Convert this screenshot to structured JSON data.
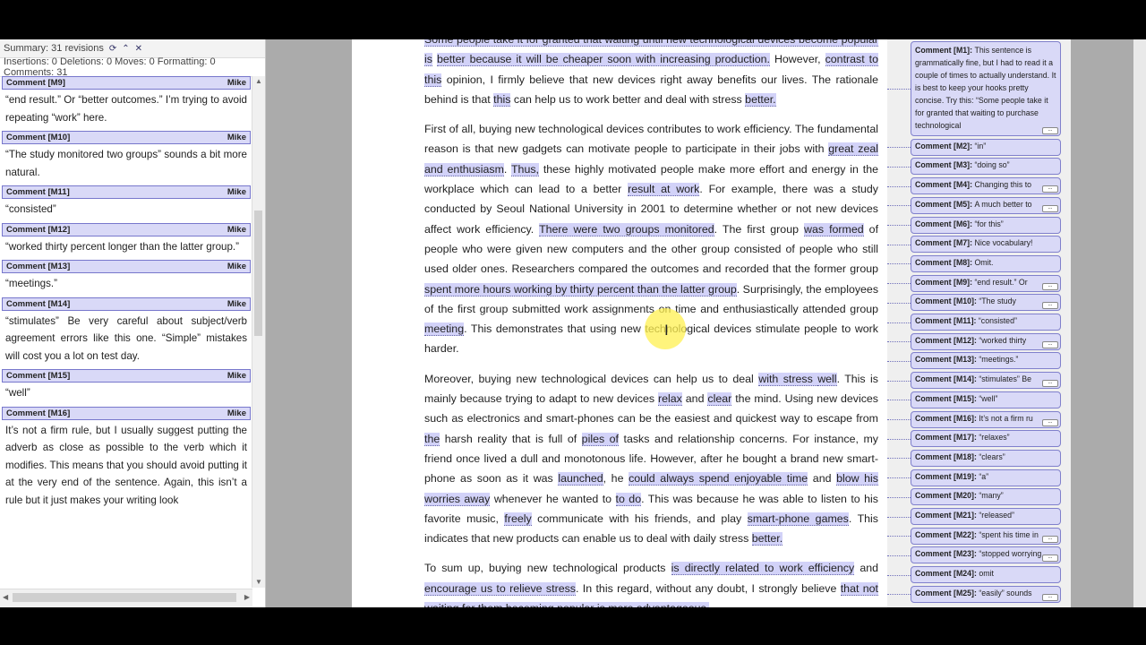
{
  "review_pane": {
    "title": "Summary: 31 revisions",
    "stats": "Insertions: 0 Deletions: 0 Moves: 0 Formatting: 0 Comments: 31",
    "entries": [
      {
        "label": "Comment [M9]",
        "author": "Mike",
        "text": "“end result.”  Or  “better outcomes.”  I’m trying to avoid repeating “work” here."
      },
      {
        "label": "Comment [M10]",
        "author": "Mike",
        "text": "“The study monitored two groups” sounds a bit more natural."
      },
      {
        "label": "Comment [M11]",
        "author": "Mike",
        "text": "“consisted”"
      },
      {
        "label": "Comment [M12]",
        "author": "Mike",
        "text": "“worked thirty percent longer than the latter group.”"
      },
      {
        "label": "Comment [M13]",
        "author": "Mike",
        "text": "“meetings.”"
      },
      {
        "label": "Comment [M14]",
        "author": "Mike",
        "text": "“stimulates”   Be very careful about subject/verb agreement errors like this one.  “Simple” mistakes will cost you a lot on test day."
      },
      {
        "label": "Comment [M15]",
        "author": "Mike",
        "text": "“well”"
      },
      {
        "label": "Comment [M16]",
        "author": "Mike",
        "text": "It’s not a firm rule, but I usually suggest putting the adverb as close as possible to the verb which it modifies.   This means that you should avoid putting it at the very end of the sentence.  Again, this isn’t a rule but it just makes your writing look"
      }
    ]
  },
  "document": {
    "p1": {
      "a": "Some people take it for granted that waiting until new technological devices become popular is",
      "b": "better because it will be cheaper soon with increasing production.",
      "c": " However, ",
      "d": "contrast to this",
      "e": "opinion, I firmly believe that new devices right away benefits our lives. The rationale behind is that ",
      "f": "this",
      "g": " can help us to work better and deal with stress ",
      "h": "better."
    },
    "p2": {
      "a": "First of all, buying new technological devices contributes to work efficiency",
      "b": ". The fundamental ",
      "c": "reason",
      "d": " is that new gadgets can motivate people to participate in their jobs with ",
      "e": "great zeal and enthusiasm",
      "f": ". ",
      "g": "Thus,",
      "h": " these highly motivated people make more effort and energy in the workplace which can lead to a better ",
      "i": "result at work",
      "j": ". For example, there was a study conducted by Seoul National University in 2001 to determine whether or not new devices affect work efficiency. ",
      "k": "There were two groups monitored",
      "l": ". The first group ",
      "m": "was formed",
      "n": " of people who were given new computers and the other group consisted of people who still used older ones. Researchers compared the outcomes and recorded that the former group ",
      "o": "spent more hours working by thirty percent than the latter group",
      "p": ". Surprisingly, the employees of the first group submitted work assignments on time and enthusiastically attended group ",
      "q": "meeting",
      "r": ". This demonstrates that using new technological devices stimulate people to work harder."
    },
    "p3": {
      "a": "Moreover, buying new technological devices can help us to deal ",
      "b": "with stress ",
      "c": "well",
      "d": ". This is mainly because trying to adapt to new devices ",
      "e": "relax",
      "f": " and ",
      "g": "clear",
      "h": " the mind. Using new devices such as electronics and smart-phones can be the easiest and quickest way to escape from ",
      "i": "the",
      "j": " harsh reality that is full of ",
      "k": "piles of",
      "l": " tasks and relationship concerns. For instance, my friend once lived a dull and monotonous life. However, after he bought a brand new smart-phone as soon as it was ",
      "m": "launched",
      "n": ", he ",
      "o": "could always spend enjoyable time",
      "p": " and ",
      "q": "blow his worries away",
      "r": " whenever he wanted to ",
      "s": "to do",
      "t": ". This was because he was able to listen to his favorite music, ",
      "u": "freely",
      "v": " communicate with his friends, and play ",
      "w": "smart-phone games",
      "x": ". This indicates that new products can enable us to deal with daily stress ",
      "y": "better."
    },
    "p4": {
      "a": "To sum up, buying new technological products ",
      "b": "is directly related to work efficiency",
      "c": " and ",
      "d": "encourage us to relieve stress",
      "e": ". In this regard, without any doubt, I strongly believe ",
      "f": "that not waiting for them becoming popular is more advantageous."
    }
  },
  "balloons": [
    {
      "label": "Comment [M1]:",
      "text": "This sentence is grammatically fine, but I had to read it a couple of times to actually understand.  It is best to keep your hooks pretty concise.   Try this: “Some people take it for granted that waiting to purchase technological"
    },
    {
      "label": "Comment [M2]:",
      "text": "“in”"
    },
    {
      "label": "Comment [M3]:",
      "text": "“doing so”"
    },
    {
      "label": "Comment [M4]:",
      "text": "Changing this to"
    },
    {
      "label": "Comment [M5]:",
      "text": "A much better to"
    },
    {
      "label": "Comment [M6]:",
      "text": "“for this”"
    },
    {
      "label": "Comment [M7]:",
      "text": "Nice vocabulary!"
    },
    {
      "label": "Comment [M8]:",
      "text": "Omit."
    },
    {
      "label": "Comment [M9]:",
      "text": "“end result.”  Or"
    },
    {
      "label": "Comment [M10]:",
      "text": "“The study"
    },
    {
      "label": "Comment [M11]:",
      "text": "“consisted”"
    },
    {
      "label": "Comment [M12]:",
      "text": "“worked thirty"
    },
    {
      "label": "Comment [M13]:",
      "text": "“meetings.”"
    },
    {
      "label": "Comment [M14]:",
      "text": "“stimulates”  Be"
    },
    {
      "label": "Comment [M15]:",
      "text": "“well”"
    },
    {
      "label": "Comment [M16]:",
      "text": "It’s not a firm ru"
    },
    {
      "label": "Comment [M17]:",
      "text": "“relaxes”"
    },
    {
      "label": "Comment [M18]:",
      "text": "“clears”"
    },
    {
      "label": "Comment [M19]:",
      "text": "“a”"
    },
    {
      "label": "Comment [M20]:",
      "text": "“many”"
    },
    {
      "label": "Comment [M21]:",
      "text": "“released”"
    },
    {
      "label": "Comment [M22]:",
      "text": "“spent his time in"
    },
    {
      "label": "Comment [M23]:",
      "text": "“stopped worrying"
    },
    {
      "label": "Comment [M24]:",
      "text": "omit"
    },
    {
      "label": "Comment [M25]:",
      "text": "“easily” sounds"
    }
  ],
  "colors": {
    "comment_fill": "#d9d9f7",
    "comment_border": "#8080cc",
    "highlight": "#d2d2f8",
    "cursor_halo": "#fff050"
  },
  "icons": {
    "refresh": "refresh-icon",
    "collapse": "collapse-icon",
    "close": "close-icon"
  }
}
